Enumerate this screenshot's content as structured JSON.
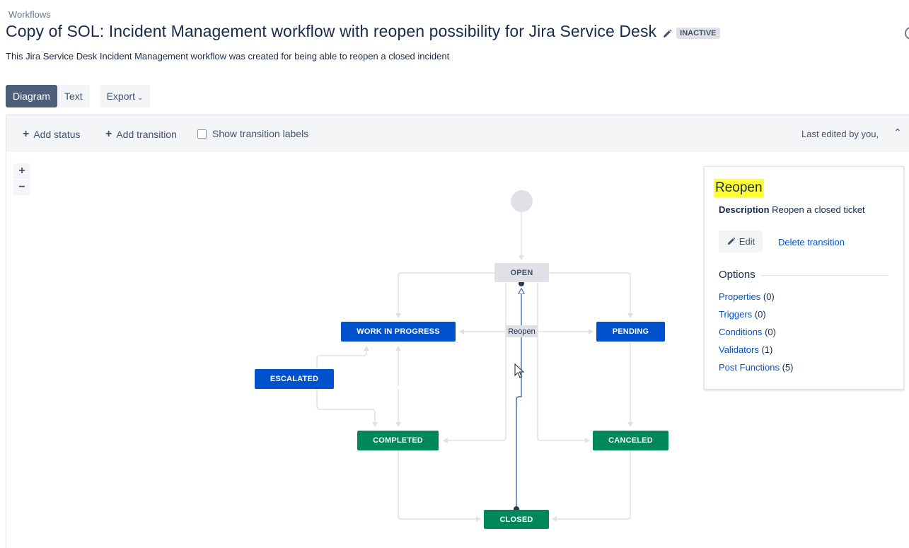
{
  "breadcrumb": "Workflows",
  "title": "Copy of SOL: Incident Management workflow with reopen possibility for Jira Service Desk",
  "status_lozenge": "INACTIVE",
  "description": "This Jira Service Desk Incident Management workflow was created for being able to reopen a closed incident",
  "tabs": {
    "diagram": "Diagram",
    "text": "Text",
    "export": "Export"
  },
  "toolbar": {
    "add_status": "Add status",
    "add_transition": "Add transition",
    "show_labels": "Show transition labels",
    "last_edited": "Last edited by you,"
  },
  "zoom": {
    "in": "+",
    "out": "−"
  },
  "statuses": {
    "open": "OPEN",
    "work_in_progress": "WORK IN PROGRESS",
    "pending": "PENDING",
    "escalated": "ESCALATED",
    "completed": "COMPLETED",
    "canceled": "CANCELED",
    "closed": "CLOSED"
  },
  "transition_label": "Reopen",
  "panel": {
    "title": "Reopen",
    "description_label": "Description",
    "description_value": "Reopen a closed ticket",
    "edit": "Edit",
    "delete": "Delete transition",
    "options_heading": "Options",
    "options": [
      {
        "label": "Properties",
        "count": "(0)"
      },
      {
        "label": "Triggers",
        "count": "(0)"
      },
      {
        "label": "Conditions",
        "count": "(0)"
      },
      {
        "label": "Validators",
        "count": "(1)"
      },
      {
        "label": "Post Functions",
        "count": "(5)"
      }
    ]
  },
  "colors": {
    "blue_status": "#0052cc",
    "green_status": "#00875a",
    "grey_status": "#dfe1e6",
    "highlight": "#ffff33",
    "selected_transition": "#3c6fb0"
  }
}
